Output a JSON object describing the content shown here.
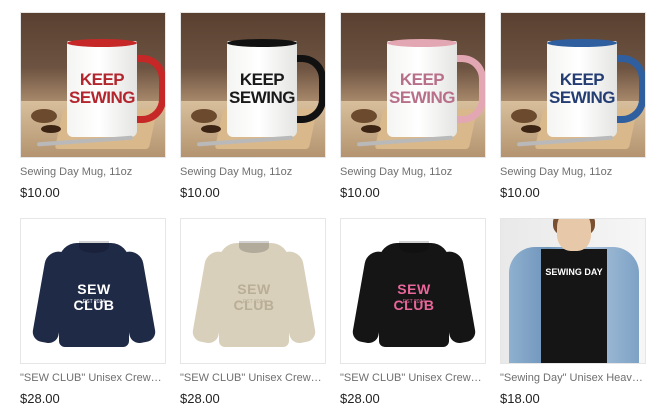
{
  "products": [
    {
      "title": "Sewing Day Mug, 11oz",
      "price": "$10.00",
      "image": {
        "kind": "mug",
        "text1": "KEEP",
        "text2": "SEWING",
        "accent": "#c62828",
        "text_color": "#b3262e"
      }
    },
    {
      "title": "Sewing Day Mug, 11oz",
      "price": "$10.00",
      "image": {
        "kind": "mug",
        "text1": "KEEP",
        "text2": "SEWING",
        "accent": "#111111",
        "text_color": "#1a1a1a"
      }
    },
    {
      "title": "Sewing Day Mug, 11oz",
      "price": "$10.00",
      "image": {
        "kind": "mug",
        "text1": "KEEP",
        "text2": "SEWING",
        "accent": "#e3a7b3",
        "text_color": "#b8708a"
      }
    },
    {
      "title": "Sewing Day Mug, 11oz",
      "price": "$10.00",
      "image": {
        "kind": "mug",
        "text1": "KEEP",
        "text2": "SEWING",
        "accent": "#2f5f9e",
        "text_color": "#243e74"
      }
    },
    {
      "title": "\"SEW CLUB\" Unisex Crewneck Sweatshirt",
      "price": "$28.00",
      "image": {
        "kind": "sweatshirt",
        "text": "SEW CLUB",
        "sub": "EST 2024",
        "color": "#1f2a47",
        "text_color": "#ffffff"
      }
    },
    {
      "title": "\"SEW CLUB\" Unisex Crewneck Sweatshirt",
      "price": "$28.00",
      "image": {
        "kind": "sweatshirt",
        "text": "SEW CLUB",
        "sub": "EST 2024",
        "color": "#d9d0bc",
        "text_color": "#b9ae96"
      }
    },
    {
      "title": "\"SEW CLUB\" Unisex Crewneck Sweatshirt",
      "price": "$28.00",
      "image": {
        "kind": "sweatshirt",
        "text": "SEW CLUB",
        "sub": "EST 2024",
        "color": "#151515",
        "text_color": "#e9669a"
      }
    },
    {
      "title": "\"Sewing Day\" Unisex Heavy Cotton Tee",
      "price": "$18.00",
      "image": {
        "kind": "tee",
        "text": "SEWING DAY"
      }
    }
  ]
}
